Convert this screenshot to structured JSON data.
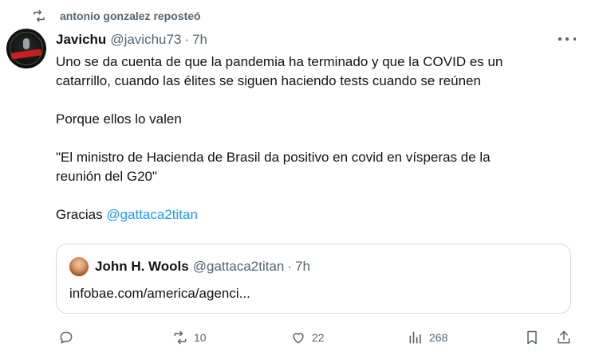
{
  "repost": {
    "icon": "repost-icon",
    "text": "antonio gonzalez reposteó"
  },
  "tweet": {
    "avatar": "avatar",
    "name": "Javichu",
    "handle": "@javichu73",
    "dot": "·",
    "time": "7h",
    "more_icon": "more-icon",
    "lines": [
      "Uno se da cuenta de que la pandemia ha terminado y que la COVID es un",
      "catarrillo, cuando las élites se siguen haciendo tests cuando se reúnen"
    ],
    "para2": "Porque ellos lo valen",
    "quote_text_lines": [
      "\"El ministro de Hacienda de Brasil da positivo en covid en vísperas de la",
      "reunión del G20\""
    ],
    "thanks": "Gracias",
    "mention": "@gattaca2titan"
  },
  "quoted": {
    "name": "John H. Wools",
    "handle": "@gattaca2titan",
    "dot": "·",
    "time": "7h",
    "link": "infobae.com/america/agenci..."
  },
  "actions": {
    "reply": {
      "icon": "reply-icon",
      "count": ""
    },
    "retweet": {
      "icon": "retweet-icon",
      "count": "10"
    },
    "like": {
      "icon": "like-icon",
      "count": "22"
    },
    "views": {
      "icon": "views-icon",
      "count": "268"
    },
    "bookmark": {
      "icon": "bookmark-icon"
    },
    "share": {
      "icon": "share-icon"
    }
  },
  "colors": {
    "text": "#0f1419",
    "muted": "#536471",
    "link": "#1d9bf0",
    "border": "#cfd9de"
  }
}
